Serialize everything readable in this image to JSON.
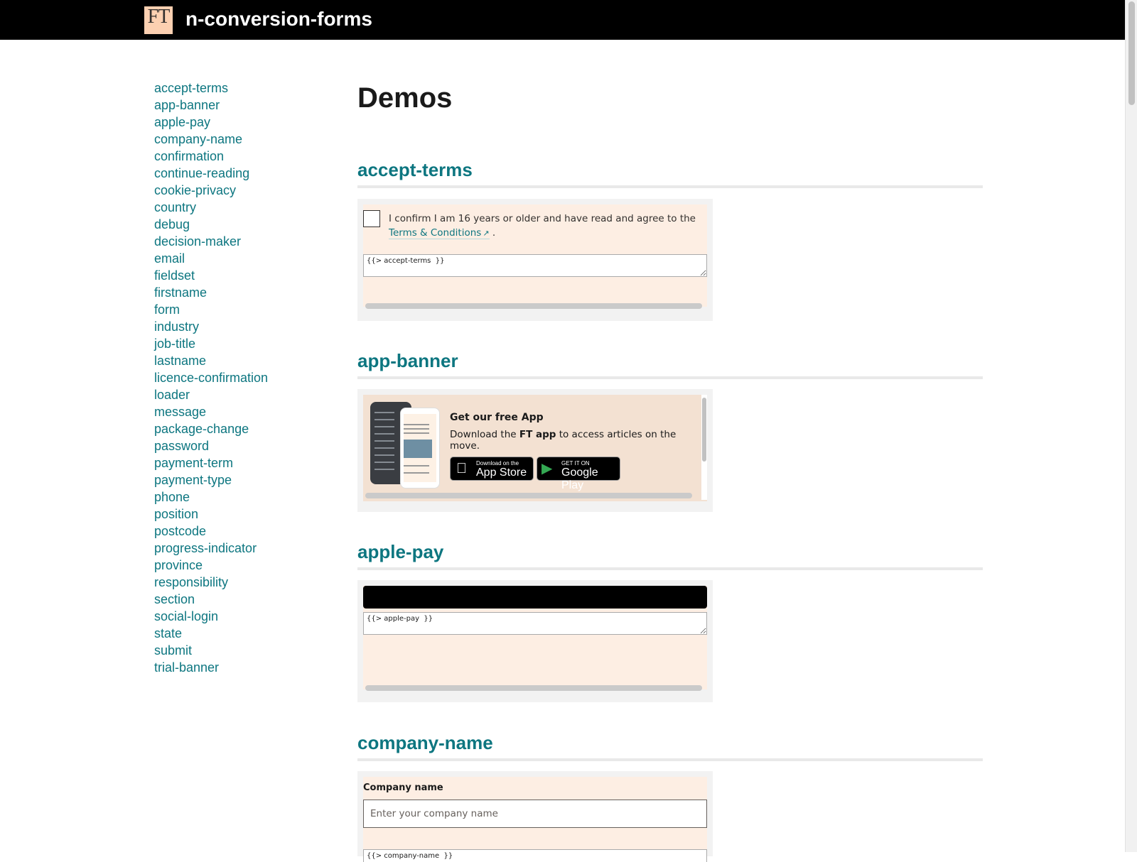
{
  "header": {
    "logo_text": "FT",
    "site_title": "n-conversion-forms"
  },
  "sidebar": {
    "items": [
      "accept-terms",
      "app-banner",
      "apple-pay",
      "company-name",
      "confirmation",
      "continue-reading",
      "cookie-privacy",
      "country",
      "debug",
      "decision-maker",
      "email",
      "fieldset",
      "firstname",
      "form",
      "industry",
      "job-title",
      "lastname",
      "licence-confirmation",
      "loader",
      "message",
      "package-change",
      "password",
      "payment-term",
      "payment-type",
      "phone",
      "position",
      "postcode",
      "progress-indicator",
      "province",
      "responsibility",
      "section",
      "social-login",
      "state",
      "submit",
      "trial-banner"
    ]
  },
  "main": {
    "page_title": "Demos",
    "sections": {
      "accept_terms": {
        "title": "accept-terms",
        "text_before": "I confirm I am 16 years or older and have read and agree to the ",
        "link_text": "Terms & Conditions",
        "text_after": ".",
        "snippet": "{{> accept-terms  }}"
      },
      "app_banner": {
        "title": "app-banner",
        "heading": "Get our free App",
        "desc_before": "Download the ",
        "desc_bold": "FT app",
        "desc_after": " to access articles on the move.",
        "app_store_small": "Download on the",
        "app_store_big": "App Store",
        "google_small": "GET IT ON",
        "google_big": "Google Play"
      },
      "apple_pay": {
        "title": "apple-pay",
        "snippet": "{{> apple-pay  }}"
      },
      "company_name": {
        "title": "company-name",
        "label": "Company name",
        "placeholder": "Enter your company name",
        "snippet": "{{> company-name  }}"
      }
    }
  },
  "colors": {
    "accent": "#0d7680",
    "header_bg": "#000000",
    "demo_bg": "#fdeee3",
    "logo_bg": "#fcd0b1"
  }
}
